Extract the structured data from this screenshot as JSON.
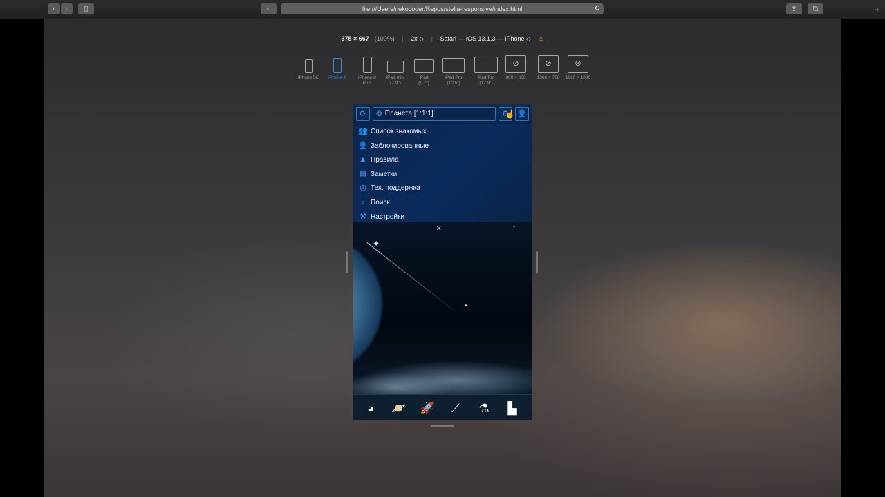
{
  "browser": {
    "url": "file:///Users/nekocoder/Repos/stella-responsive/index.html"
  },
  "rdm": {
    "dimensions": "375 × 667",
    "zoom": "(100%)",
    "scale": "2x ◇",
    "user_agent": "Safari — iOS 13.1.3 — iPhone ◇",
    "warning": "⚠",
    "devices": [
      {
        "label": "iPhone 5E"
      },
      {
        "label": "iPhone 8"
      },
      {
        "label": "iPhone 8\nPlus"
      },
      {
        "label": "iPad mini\n(7.9\")"
      },
      {
        "label": "iPad\n(9.7\")"
      },
      {
        "label": "iPad Pro\n(10.5\")"
      },
      {
        "label": "iPad Pro\n(12.9\")"
      },
      {
        "label": "800 × 600"
      },
      {
        "label": "1366 × 768"
      },
      {
        "label": "1920 × 1080"
      }
    ],
    "active_device": "iPhone 8"
  },
  "app": {
    "planet_label": "Планета [1:1:1]",
    "menu": [
      {
        "label": "Список знакомых",
        "icon": "friends-icon"
      },
      {
        "label": "Заблокированные",
        "icon": "blocked-users-icon"
      },
      {
        "label": "Правила",
        "icon": "warning-icon"
      },
      {
        "label": "Заметки",
        "icon": "notes-icon"
      },
      {
        "label": "Тех. поддержка",
        "icon": "support-icon"
      },
      {
        "label": "Поиск",
        "icon": "search-icon"
      },
      {
        "label": "Настройки",
        "icon": "settings-tools-icon"
      }
    ],
    "bottom_nav": [
      {
        "icon": "planet-icon"
      },
      {
        "icon": "galaxy-icon"
      },
      {
        "icon": "rocket-icon"
      },
      {
        "icon": "defense-cannon-icon"
      },
      {
        "icon": "research-flask-icon"
      },
      {
        "icon": "buildings-icon"
      }
    ]
  },
  "colors": {
    "accent": "#2f8ef6",
    "menu_icon": "#3aa2ff"
  }
}
